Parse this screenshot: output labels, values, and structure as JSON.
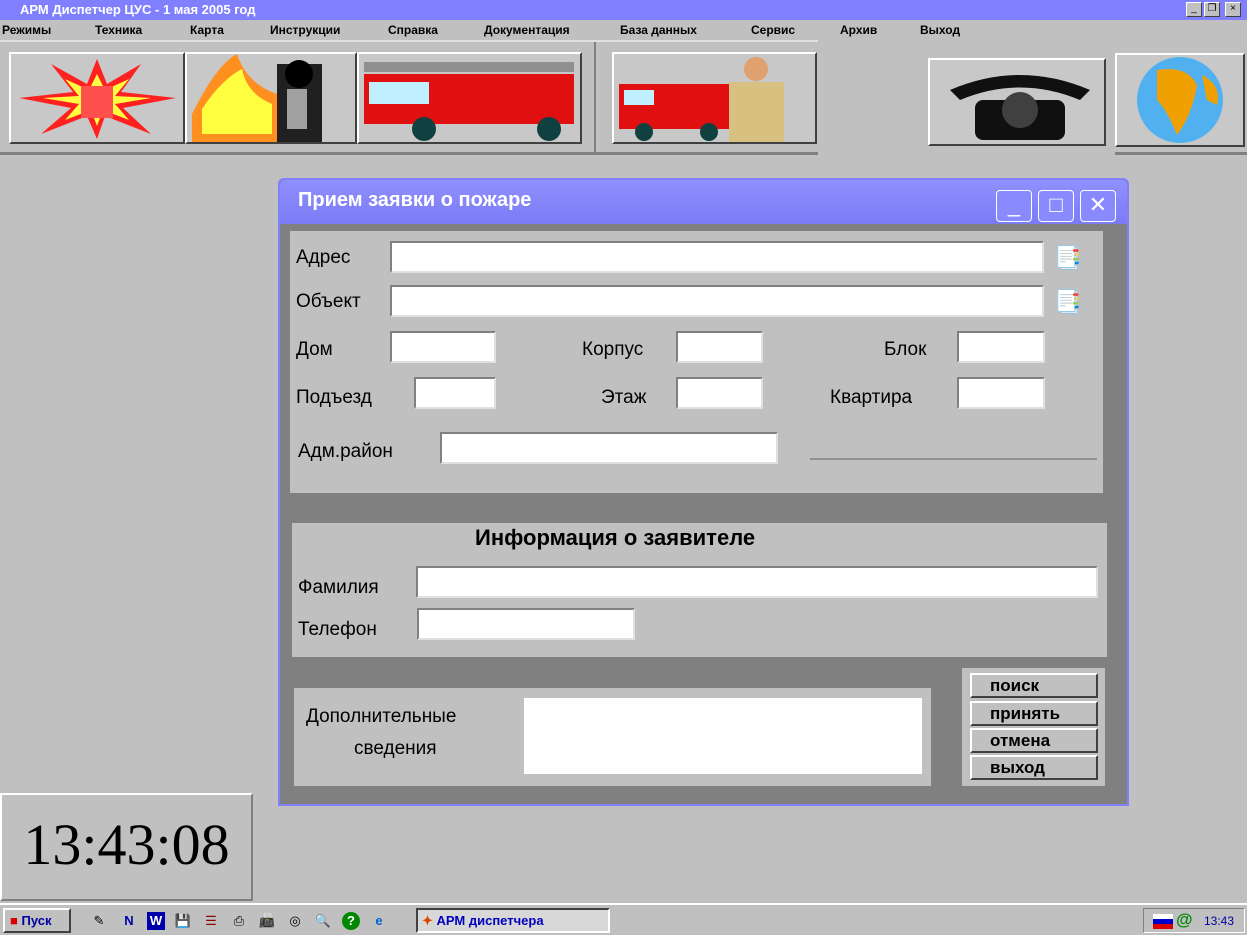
{
  "window": {
    "title": "АРМ  Диспетчер  ЦУС  -  1 мая 2005 год"
  },
  "menu": [
    "Режимы",
    "Техника",
    "Карта",
    "Инструкции",
    "Справка",
    "Документация",
    "База данных",
    "Сервис",
    "Архив",
    "Выход"
  ],
  "dialog": {
    "title": "Прием заявки о пожаре",
    "fields": {
      "address": "Адрес",
      "object": "Объект",
      "house": "Дом",
      "building": "Корпус",
      "block": "Блок",
      "entrance": "Подъезд",
      "floor": "Этаж",
      "apartment": "Квартира",
      "district": "Адм.район"
    },
    "applicant": {
      "heading": "Информация о заявителе",
      "surname": "Фамилия",
      "phone": "Телефон"
    },
    "extra": {
      "line1": "Дополнительные",
      "line2": "сведения"
    },
    "buttons": {
      "search": "поиск",
      "accept": "принять",
      "cancel": "отмена",
      "exit": "выход"
    }
  },
  "clock": "13:43:08",
  "taskbar": {
    "start": "Пуск",
    "task": "АРМ диспетчера",
    "time": "13:43"
  }
}
